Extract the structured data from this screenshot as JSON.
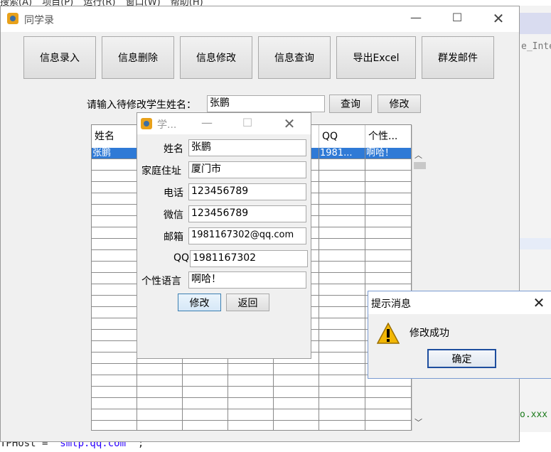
{
  "ide": {
    "menu": [
      "搜索(A)",
      "项目(P)",
      "运行(R)",
      "窗口(W)",
      "帮助(H)"
    ],
    "right_fragment": "e_Inte",
    "right_code": "o.xxx",
    "bottom_code_prefix": "TPHost = ",
    "bottom_code_string": "\"smtp.qq.com\"",
    "bottom_code_suffix": ";"
  },
  "main": {
    "title": "同学录",
    "toolbar": [
      "信息录入",
      "信息删除",
      "信息修改",
      "信息查询",
      "导出Excel",
      "群发邮件"
    ],
    "prompt_label": "请输入待修改学生姓名：",
    "name_input": "张鹏",
    "query_button": "查询",
    "modify_button": "修改",
    "table": {
      "headers": [
        "姓名",
        "",
        "",
        "",
        "",
        "QQ",
        "个性..."
      ],
      "selected_row": [
        "张鹏",
        "",
        "",
        "",
        "",
        "1981...",
        "啊哈！"
      ],
      "empty_rows": 24
    }
  },
  "editor": {
    "title": "学...",
    "fields": [
      {
        "label": "姓名",
        "value": "张鹏"
      },
      {
        "label": "家庭住址",
        "value": "厦门市"
      },
      {
        "label": "电话",
        "value": "123456789"
      },
      {
        "label": "微信",
        "value": "123456789"
      },
      {
        "label": "邮箱",
        "value": "1981167302@qq.com"
      },
      {
        "label": "QQ",
        "value": "1981167302"
      },
      {
        "label": "个性语言",
        "value": "啊哈！"
      }
    ],
    "modify_button": "修改",
    "back_button": "返回"
  },
  "message": {
    "title": "提示消息",
    "text": "修改成功",
    "ok_button": "确定",
    "icon": "warning-icon"
  }
}
